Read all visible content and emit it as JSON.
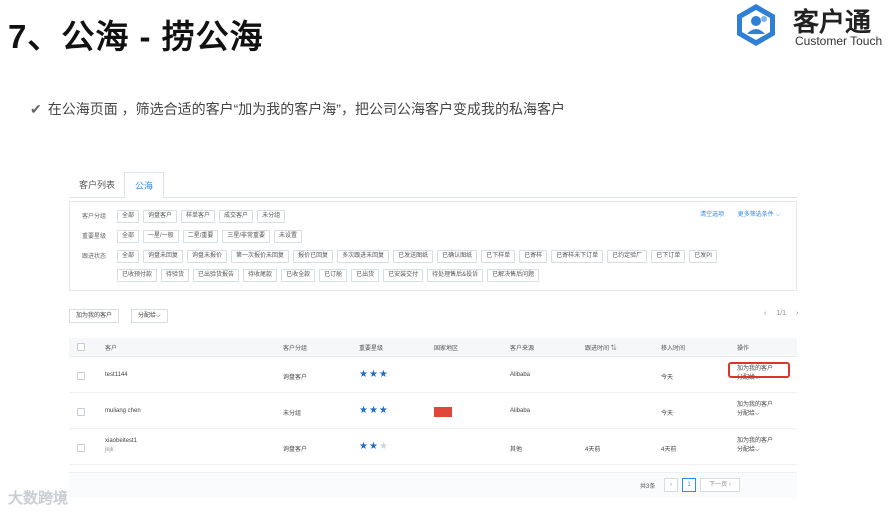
{
  "slide": {
    "title": "7、公海 - 捞公海",
    "intro": "在公海页面 ，筛选合适的客户“加为我的客户海”，把公司公海客户变成我的私海客户",
    "check_icon": "✔"
  },
  "brand": {
    "name": "客户通",
    "subtitle": "Customer Touch",
    "logo_color": "#2f7fd6"
  },
  "tabs": [
    {
      "label": "客户列表",
      "active": false
    },
    {
      "label": "公海",
      "active": true
    }
  ],
  "filters": {
    "links": [
      "清空选项",
      "更多筛选条件 ⌵"
    ],
    "rows": [
      {
        "label": "客户分组",
        "chips": [
          "全部",
          "询盘客户",
          "样单客户",
          "成交客户",
          "未分组"
        ]
      },
      {
        "label": "重要星级",
        "chips": [
          "全部",
          "一星/一般",
          "二星/重要",
          "三星/非常重要",
          "未设置"
        ]
      },
      {
        "label": "跟进状态",
        "chips": [
          "全部",
          "询盘未回复",
          "询盘未报价",
          "第一次报价未回复",
          "报价已回复",
          "多次跟进未回复",
          "已发送图纸",
          "已确认图纸",
          "已下样单",
          "已寄样",
          "已寄样未下订单",
          "已约定验厂",
          "已下订单",
          "已发PI"
        ]
      },
      {
        "label": "",
        "chips": [
          "已收预付款",
          "待验货",
          "已出验货报告",
          "待收尾款",
          "已收全款",
          "已订舱",
          "已出货",
          "已安装交付",
          "待处理售后&投诉",
          "已解决售后问题"
        ]
      }
    ]
  },
  "actions": {
    "add_mine": "加为我的客户",
    "assign": "分配给⌵"
  },
  "pager_top": {
    "prev": "‹",
    "page": "1/1",
    "next": "›"
  },
  "table": {
    "headers": [
      "客户",
      "客户分组",
      "重要星级",
      "国家地区",
      "客户来源",
      "跟进时间 ⇅",
      "移入时间",
      "操作"
    ],
    "rows": [
      {
        "name": "test1144",
        "sub": "",
        "group": "询盘客户",
        "stars": 3,
        "flag": false,
        "source": "Alibaba",
        "follow": "",
        "moved": "今天",
        "op1": "加为我的客户",
        "op2": "分配给⌵"
      },
      {
        "name": "muliang chen",
        "sub": "",
        "group": "未分组",
        "stars": 3,
        "flag": true,
        "source": "Alibaba",
        "follow": "",
        "moved": "今天",
        "op1": "加为我的客户",
        "op2": "分配给⌵"
      },
      {
        "name": "xiaobeitest1",
        "sub": "jkjk",
        "group": "询盘客户",
        "stars": 2,
        "flag": true,
        "source": "其他",
        "follow": "4天前",
        "moved": "4天前",
        "op1": "加为我的客户",
        "op2": "分配给⌵"
      }
    ]
  },
  "pager_bottom": {
    "total": "共3条",
    "prev": "‹",
    "page": "1",
    "next": "下一页 ›"
  },
  "watermark": "大数跨境",
  "colors": {
    "accent": "#2d8cf0",
    "highlight": "#d9372e",
    "flag": "#e0463a",
    "star": "#1f6fc5"
  }
}
